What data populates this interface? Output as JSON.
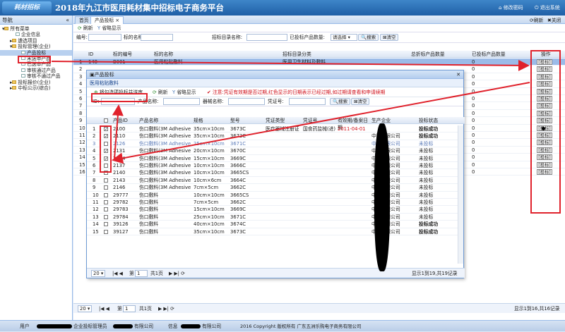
{
  "header": {
    "title": "2018年九江市医用耗材集中招标电子商务平台",
    "logo_text": "耗材招标",
    "link_home": "首页",
    "link_pwd": "修改密码",
    "link_exit": "退出系统"
  },
  "sidebar": {
    "title": "导航",
    "collapse": "«",
    "items": [
      "所有菜单",
      "企业信息",
      "遴选项目",
      "投标管理(企业)",
      "产品投标",
      "未送审产品",
      "已送审产品",
      "审核通过产品",
      "审核不通过产品",
      "投标报价(企业)",
      "中标公示(综合)"
    ]
  },
  "tabs": {
    "home": "首页",
    "product": "产品投标 ×"
  },
  "right_actions": {
    "refresh": "刷新",
    "close": "关闭"
  },
  "toolbar": {
    "refresh": "刷新",
    "advanced": "省略显示"
  },
  "search": {
    "code": "编号:",
    "bid_name": "标的名称:",
    "catalog_name": "招标目录名称:",
    "count": "已投标产品数量:",
    "select_value": "请选择",
    "search_btn": "搜索",
    "clear_btn": "清空"
  },
  "main_grid": {
    "headers": [
      "ID",
      "标的编号",
      "标的名称",
      "招标目录分类",
      "总折标产品数量",
      "已投标产品数量",
      "操作"
    ],
    "row": {
      "num": "1",
      "id": "148",
      "code": "B001",
      "name": "医用粘贴敷料",
      "cat": "医用卫生材料及敷料",
      "total": "",
      "done": "0",
      "op": "[投标]"
    },
    "right_vals": [
      "0",
      "0",
      "0",
      "0",
      "0",
      "0",
      "0",
      "0",
      "0",
      "0",
      "0",
      "0",
      "0",
      "0",
      "0",
      "0"
    ],
    "row_nums": [
      "1",
      "2",
      "3",
      "4",
      "5",
      "6",
      "7",
      "8",
      "9",
      "10",
      "11",
      "12",
      "13",
      "14",
      "15",
      "16"
    ],
    "op_label": "[投标]"
  },
  "dialog": {
    "title": "产品投标",
    "subtitle": "医用粘贴敷料",
    "btn_bid": "将勾选项投标并送审",
    "btn_refresh": "刷新",
    "btn_omit": "省略显示",
    "notice_label": "注意:",
    "notice": "凭证有效期是否过期,红色显示的日期表示已经过期,如过期请查看和申请续期",
    "search": {
      "id": "ID:",
      "name": "产品名称:",
      "spec": "器械名称:",
      "cert": "凭证号:",
      "search_btn": "搜索",
      "clear_btn": "清空"
    },
    "headers": [
      "产品ID",
      "产品名称",
      "规格",
      "型号",
      "凭证类型",
      "凭证号",
      "有效期/备案日期",
      "生产企业",
      "投标状态"
    ],
    "rows": [
      {
        "n": "1",
        "checked": true,
        "id": "2100",
        "name": "伤口敷料(3M Adhesive",
        "spec": "35cm×10cm",
        "model": "3673C",
        "ctype": "医疗器械注册证",
        "cno": "国食药监械(进)",
        "date": "2011-04-01",
        "maker": "",
        "status": "投标成功"
      },
      {
        "n": "2",
        "checked": true,
        "id": "2110",
        "name": "伤口敷料(3M Adhesive",
        "spec": "35cm×10cm",
        "model": "3672C",
        "ctype": "",
        "cno": "",
        "date": "",
        "maker": "中国有限公司",
        "status": "投标成功"
      },
      {
        "n": "3",
        "checked": false,
        "id": "2126",
        "name": "伤口敷料(3M Adhesive",
        "spec": "25cm×10cm",
        "model": "3671C",
        "ctype": "",
        "cno": "",
        "date": "",
        "maker": "中国有限公司",
        "status": "未投标"
      },
      {
        "n": "4",
        "checked": true,
        "id": "2131",
        "name": "伤口敷料(3M Adhesive",
        "spec": "20cm×10cm",
        "model": "3670C",
        "ctype": "",
        "cno": "",
        "date": "",
        "maker": "中国有限公司",
        "status": "未投标"
      },
      {
        "n": "5",
        "checked": true,
        "id": "2134",
        "name": "伤口敷料(3M Adhesive",
        "spec": "15cm×10cm",
        "model": "3669C",
        "ctype": "",
        "cno": "",
        "date": "",
        "maker": "中国有限公司",
        "status": "未投标"
      },
      {
        "n": "6",
        "checked": false,
        "id": "2137",
        "name": "伤口敷料(3M Adhesive",
        "spec": "10cm×10cm",
        "model": "3666C",
        "ctype": "",
        "cno": "",
        "date": "",
        "maker": "中国有限公司",
        "status": "未投标"
      },
      {
        "n": "7",
        "checked": false,
        "id": "2140",
        "name": "伤口敷料(3M Adhesive",
        "spec": "10cm×10cm",
        "model": "3665CS",
        "ctype": "",
        "cno": "",
        "date": "",
        "maker": "中国有限公司",
        "status": "未投标"
      },
      {
        "n": "8",
        "checked": false,
        "id": "2143",
        "name": "伤口敷料(3M Adhesive",
        "spec": "10cm×6cm",
        "model": "3664C",
        "ctype": "",
        "cno": "",
        "date": "",
        "maker": "中国有限公司",
        "status": "未投标"
      },
      {
        "n": "9",
        "checked": false,
        "id": "2146",
        "name": "伤口敷料(3M Adhesive",
        "spec": "7cm×5cm",
        "model": "3662C",
        "ctype": "",
        "cno": "",
        "date": "",
        "maker": "中国有限公司",
        "status": "未投标"
      },
      {
        "n": "10",
        "checked": false,
        "id": "29777",
        "name": "伤口敷料",
        "spec": "10cm×10cm",
        "model": "3665CS",
        "ctype": "",
        "cno": "",
        "date": "",
        "maker": "中国有限公司",
        "status": "未投标"
      },
      {
        "n": "11",
        "checked": false,
        "id": "29782",
        "name": "伤口敷料",
        "spec": "7cm×5cm",
        "model": "3662C",
        "ctype": "",
        "cno": "",
        "date": "",
        "maker": "中国有限公司",
        "status": "未投标"
      },
      {
        "n": "12",
        "checked": false,
        "id": "29783",
        "name": "伤口敷料",
        "spec": "15cm×10cm",
        "model": "3669C",
        "ctype": "",
        "cno": "",
        "date": "",
        "maker": "中国有限公司",
        "status": "未投标"
      },
      {
        "n": "13",
        "checked": false,
        "id": "29784",
        "name": "伤口敷料",
        "spec": "25cm×10cm",
        "model": "3671C",
        "ctype": "",
        "cno": "",
        "date": "",
        "maker": "中国有限公司",
        "status": "未投标"
      },
      {
        "n": "14",
        "checked": false,
        "id": "39126",
        "name": "伤口敷料",
        "spec": "40cm×10cm",
        "model": "3674C",
        "ctype": "",
        "cno": "",
        "date": "",
        "maker": "中国有限公司",
        "status": "投标成功"
      },
      {
        "n": "15",
        "checked": false,
        "id": "39127",
        "name": "伤口敷料",
        "spec": "35cm×10cm",
        "model": "3673C",
        "ctype": "",
        "cno": "",
        "date": "",
        "maker": "中国有限公司",
        "status": "投标成功"
      }
    ],
    "pager": {
      "size": "20",
      "page_label": "第",
      "page": "1",
      "total_pages": "共1页",
      "summary": "显示1到19,共19记录"
    }
  },
  "main_pager": {
    "size": "20",
    "page_label": "第",
    "page": "1",
    "total_pages": "共1页",
    "summary": "显示1到16,共16记录"
  },
  "footer": {
    "user_label": "用户",
    "role": "企业投标管理员",
    "company_suffix": "有限公司",
    "info_label": "信息",
    "info_suffix": "有限公司",
    "copyright": "2016 Copyright 版权所有 广东五洲乐购电子商务有限公司"
  }
}
